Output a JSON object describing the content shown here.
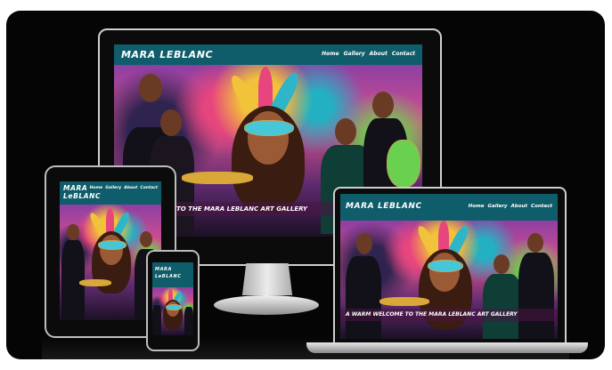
{
  "site": {
    "brand": "MARA LEBLANC",
    "brand_short": "MARA LeBLANC",
    "nav": [
      "Home",
      "Gallery",
      "About",
      "Contact"
    ],
    "banner_desktop": "TO THE MARA LEBLANC ART GALLERY",
    "banner_laptop": "A WARM WELCOME TO THE MARA LEBLANC ART GALLERY"
  },
  "colors": {
    "header": "#0f5d6b",
    "background": "#050505"
  }
}
